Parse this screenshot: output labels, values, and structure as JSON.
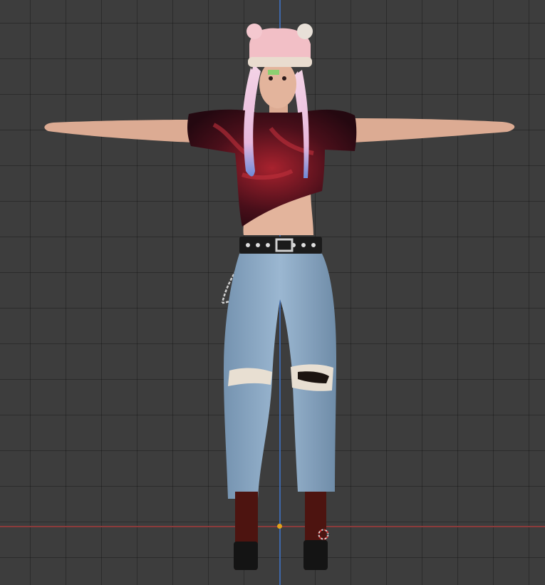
{
  "viewport": {
    "background_color": "#3d3d3d",
    "grid_color": "#2c2c2c",
    "axis_x_color": "#8a3b3b",
    "axis_y_color": "#3e67a8",
    "origin_color": "#e2a21b"
  },
  "model": {
    "name": "character-t-pose",
    "palette": {
      "skin": "#e3b49c",
      "hair": "#f0c4de",
      "hat": "#f2bfc6",
      "shirt": "#3a0d17",
      "shirt_accent": "#c2303c",
      "jeans": "#87a6c4",
      "belt": "#1b1b1b",
      "boots": "#4d1410"
    }
  },
  "icons": {
    "cursor": "3d-cursor-icon"
  }
}
